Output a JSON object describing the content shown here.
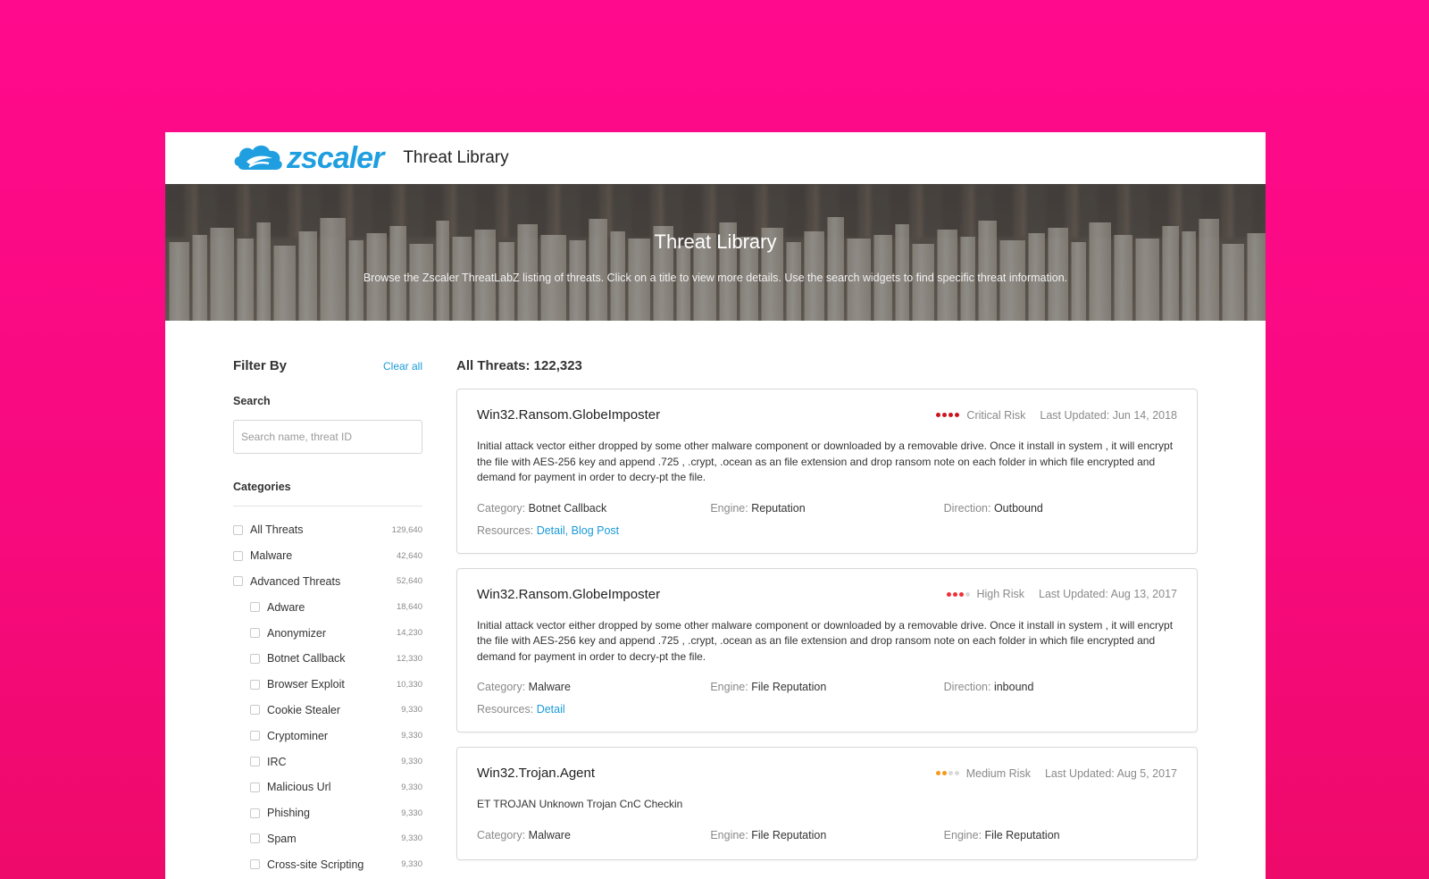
{
  "header": {
    "brand": "zscaler",
    "title": "Threat Library"
  },
  "hero": {
    "title": "Threat Library",
    "subtitle": "Browse the Zscaler ThreatLabZ listing of threats. Click on a title to view more details. Use the search widgets to find specific threat information."
  },
  "sidebar": {
    "filter_title": "Filter By",
    "clear_all": "Clear all",
    "search_label": "Search",
    "search_placeholder": "Search name, threat ID",
    "categories_label": "Categories",
    "categories": [
      {
        "name": "All Threats",
        "count": "129,640",
        "sub": false
      },
      {
        "name": "Malware",
        "count": "42,640",
        "sub": false
      },
      {
        "name": "Advanced Threats",
        "count": "52,640",
        "sub": false
      },
      {
        "name": "Adware",
        "count": "18,640",
        "sub": true
      },
      {
        "name": "Anonymizer",
        "count": "14,230",
        "sub": true
      },
      {
        "name": "Botnet Callback",
        "count": "12,330",
        "sub": true
      },
      {
        "name": "Browser Exploit",
        "count": "10,330",
        "sub": true
      },
      {
        "name": "Cookie Stealer",
        "count": "9,330",
        "sub": true
      },
      {
        "name": "Cryptominer",
        "count": "9,330",
        "sub": true
      },
      {
        "name": "IRC",
        "count": "9,330",
        "sub": true
      },
      {
        "name": "Malicious Url",
        "count": "9,330",
        "sub": true
      },
      {
        "name": "Phishing",
        "count": "9,330",
        "sub": true
      },
      {
        "name": "Spam",
        "count": "9,330",
        "sub": true
      },
      {
        "name": "Cross-site Scripting",
        "count": "9,330",
        "sub": true
      }
    ]
  },
  "main": {
    "all_threats": "All Threats: 122,323",
    "threats": [
      {
        "title": "Win32.Ransom.GlobeImposter",
        "risk": "Critical Risk",
        "risk_level": 4,
        "risk_color": "#c9151e",
        "updated": "Last Updated: Jun 14, 2018",
        "description": "Initial attack vector either dropped by some other malware component or downloaded by a removable drive. Once it install in system , it will encrypt the file with AES-256 key and append .725 , .crypt, .ocean as an file extension and drop ransom note on each folder in which file encrypted and demand for payment in order to decry-pt the file.",
        "meta": [
          {
            "k": "Category: ",
            "v": "Botnet Callback"
          },
          {
            "k": "Engine: ",
            "v": "Reputation"
          },
          {
            "k": "Direction: ",
            "v": "Outbound"
          }
        ],
        "resources_label": "Resources: ",
        "resources": [
          "Detail,",
          "Blog Post"
        ]
      },
      {
        "title": "Win32.Ransom.GlobeImposter",
        "risk": "High Risk",
        "risk_level": 3,
        "risk_color": "#f0303a",
        "updated": "Last Updated: Aug 13, 2017",
        "description": "Initial attack vector either dropped by some other malware component or downloaded by a removable drive. Once it install in system , it will encrypt the file with AES-256 key and append .725 , .crypt, .ocean as an file extension and drop ransom note on each folder in which file encrypted and demand for payment in order to decry-pt the file.",
        "meta": [
          {
            "k": "Category: ",
            "v": "Malware"
          },
          {
            "k": "Engine: ",
            "v": "File Reputation"
          },
          {
            "k": "Direction: ",
            "v": "inbound"
          }
        ],
        "resources_label": "Resources: ",
        "resources": [
          "Detail"
        ]
      },
      {
        "title": "Win32.Trojan.Agent",
        "risk": "Medium Risk",
        "risk_level": 2,
        "risk_color": "#f59a1b",
        "updated": "Last Updated: Aug 5, 2017",
        "description": "ET TROJAN Unknown Trojan CnC Checkin",
        "meta": [
          {
            "k": "Category: ",
            "v": "Malware"
          },
          {
            "k": "Engine: ",
            "v": "File Reputation"
          },
          {
            "k": "Engine: ",
            "v": "File Reputation"
          }
        ],
        "resources_label": "",
        "resources": []
      }
    ]
  }
}
